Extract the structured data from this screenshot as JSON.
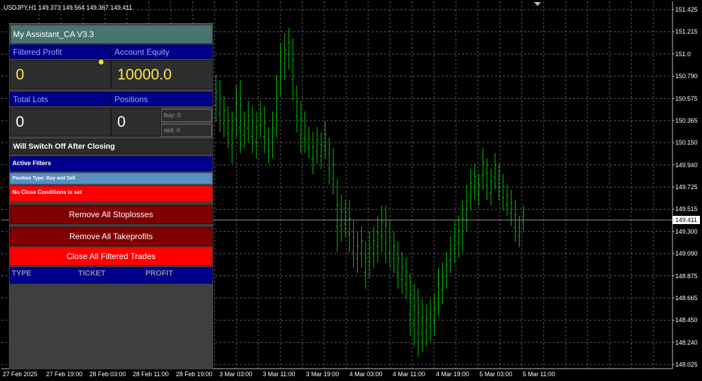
{
  "symbol_header": "USDJPY,H1  149.373 149.564 149.367 149.411",
  "price_axis": [
    "151.425",
    "151.215",
    "151.0",
    "150.790",
    "150.575",
    "150.365",
    "150.150",
    "149.940",
    "149.725",
    "149.515",
    "149.300",
    "149.090",
    "148.875",
    "148.665",
    "148.450",
    "148.240",
    "148.025"
  ],
  "current_price": "149.411",
  "time_axis": [
    "27 Feb 2025",
    "27 Feb 19:00",
    "28 Feb 03:00",
    "28 Feb 11:00",
    "28 Feb 19:00",
    "3 Mar 03:00",
    "3 Mar 11:00",
    "3 Mar 19:00",
    "4 Mar 03:00",
    "4 Mar 11:00",
    "4 Mar 19:00",
    "5 Mar 03:00",
    "5 Mar 11:00"
  ],
  "colors": {
    "background": "#000000",
    "grid": "#5a5a5a",
    "candle": "#00c800",
    "panel": "#3f3f3f",
    "header_blue": "#00008b",
    "remove_button": "#800000",
    "close_button": "#ff0000"
  },
  "chart_data": {
    "type": "bar",
    "x": "hourly bars (H1), 27 Feb 2025 – 5 Mar 11:00",
    "ylim": [
      148.025,
      151.425
    ],
    "grid": true,
    "bars": [
      [
        150.8,
        150.35
      ],
      [
        150.75,
        150.25
      ],
      [
        150.6,
        150.2
      ],
      [
        150.5,
        150.1
      ],
      [
        150.45,
        149.95
      ],
      [
        150.7,
        150.2
      ],
      [
        150.75,
        150.05
      ],
      [
        150.45,
        150.1
      ],
      [
        150.55,
        150.15
      ],
      [
        150.5,
        150.05
      ],
      [
        150.45,
        150.0
      ],
      [
        150.55,
        150.2
      ],
      [
        150.5,
        150.05
      ],
      [
        150.3,
        149.95
      ],
      [
        150.45,
        150.0
      ],
      [
        150.8,
        150.2
      ],
      [
        151.1,
        150.6
      ],
      [
        151.2,
        150.75
      ],
      [
        151.25,
        150.85
      ],
      [
        151.15,
        150.55
      ],
      [
        150.7,
        150.25
      ],
      [
        150.55,
        150.05
      ],
      [
        150.45,
        150.05
      ],
      [
        150.3,
        150.0
      ],
      [
        150.25,
        149.85
      ],
      [
        150.3,
        149.95
      ],
      [
        150.25,
        149.9
      ],
      [
        150.35,
        150.0
      ],
      [
        150.2,
        149.75
      ],
      [
        150.1,
        149.65
      ],
      [
        149.8,
        149.1
      ],
      [
        149.65,
        149.2
      ],
      [
        149.6,
        149.25
      ],
      [
        149.6,
        149.1
      ],
      [
        149.4,
        148.95
      ],
      [
        149.3,
        148.9
      ],
      [
        149.35,
        148.95
      ],
      [
        149.2,
        148.75
      ],
      [
        149.3,
        148.85
      ],
      [
        149.35,
        148.95
      ],
      [
        149.45,
        149.0
      ],
      [
        149.55,
        149.1
      ],
      [
        149.55,
        149.0
      ],
      [
        149.4,
        148.95
      ],
      [
        149.3,
        148.9
      ],
      [
        149.2,
        148.75
      ],
      [
        149.1,
        148.7
      ],
      [
        149.05,
        148.65
      ],
      [
        148.9,
        148.3
      ],
      [
        148.8,
        148.2
      ],
      [
        148.75,
        148.1
      ],
      [
        148.65,
        148.15
      ],
      [
        148.6,
        148.2
      ],
      [
        148.65,
        148.25
      ],
      [
        148.7,
        148.3
      ],
      [
        148.95,
        148.5
      ],
      [
        149.0,
        148.6
      ],
      [
        149.1,
        148.75
      ],
      [
        149.25,
        148.9
      ],
      [
        149.4,
        149.0
      ],
      [
        149.45,
        149.05
      ],
      [
        149.6,
        149.1
      ],
      [
        149.75,
        149.3
      ],
      [
        149.9,
        149.5
      ],
      [
        149.95,
        149.6
      ],
      [
        149.85,
        149.55
      ],
      [
        150.1,
        149.7
      ],
      [
        150.0,
        149.6
      ],
      [
        149.9,
        149.55
      ],
      [
        150.05,
        149.7
      ],
      [
        149.95,
        149.6
      ],
      [
        149.85,
        149.5
      ],
      [
        149.75,
        149.45
      ],
      [
        149.7,
        149.35
      ],
      [
        149.6,
        149.2
      ],
      [
        149.45,
        149.15
      ],
      [
        149.55,
        149.3
      ]
    ]
  },
  "panel": {
    "title": "My Assistant_CA V3.3",
    "filtered_profit_label": "Filtered Profit",
    "filtered_profit_value": "0",
    "account_equity_label": "Account Equity",
    "account_equity_value": "10000.0",
    "total_lots_label": "Total Lots",
    "total_lots_value": "0",
    "positions_label": "Positions",
    "positions_value": "0",
    "buy_count": "buy: 0",
    "sell_count": "sell: 0",
    "switch_off_text": "Will Switch Off After Closing",
    "active_filters_label": "Active Filters",
    "position_type_text": "Position Type: Buy and Sell",
    "no_close_text": "No Close Conditions is set",
    "remove_stoplosses_label": "Remove All Stoplosses",
    "remove_takeprofits_label": "Remove All Takeprofits",
    "close_filtered_label": "Close All Filtered Trades",
    "table_headers": [
      "TYPE",
      "TICKET",
      "PROFIT"
    ]
  }
}
